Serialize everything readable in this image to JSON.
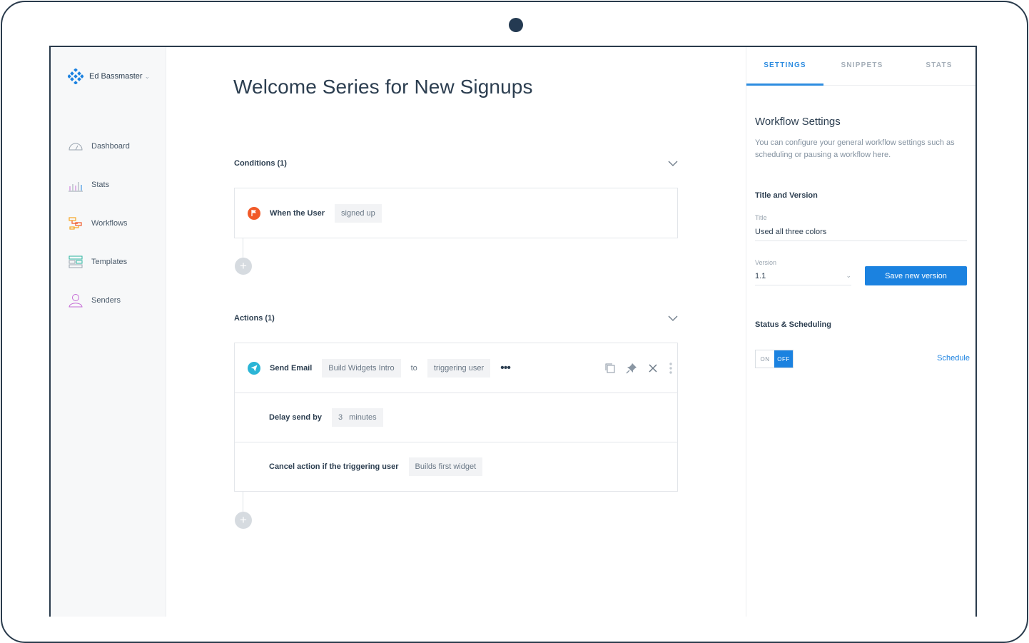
{
  "account": {
    "name": "Ed Bassmaster"
  },
  "sidebar": {
    "items": [
      {
        "label": "Dashboard",
        "icon": "dashboard-gauge-icon"
      },
      {
        "label": "Stats",
        "icon": "stats-bars-icon"
      },
      {
        "label": "Workflows",
        "icon": "workflows-icon"
      },
      {
        "label": "Templates",
        "icon": "templates-icon"
      },
      {
        "label": "Senders",
        "icon": "senders-user-icon"
      }
    ]
  },
  "main": {
    "title": "Welcome Series for New Signups",
    "conditions": {
      "heading": "Conditions (1)",
      "rows": [
        {
          "label": "When the User",
          "value": "signed up"
        }
      ]
    },
    "actions": {
      "heading": "Actions (1)",
      "send": {
        "label": "Send Email",
        "template": "Build Widgets Intro",
        "to": "to",
        "recipient": "triggering user",
        "more": "•••"
      },
      "delay": {
        "label": "Delay send by",
        "amount": "3",
        "unit": "minutes"
      },
      "cancel": {
        "label": "Cancel action if the triggering user",
        "value": "Builds first widget"
      }
    }
  },
  "panel": {
    "tabs": [
      "SETTINGS",
      "SNIPPETS",
      "STATS"
    ],
    "title": "Workflow Settings",
    "description": "You can configure your general workflow settings such as scheduling or pausing a workflow here.",
    "title_version_heading": "Title and Version",
    "title_label": "Title",
    "title_value": "Used all three colors",
    "version_label": "Version",
    "version_value": "1.1",
    "save_label": "Save new version",
    "status_heading": "Status & Scheduling",
    "toggle_on": "ON",
    "toggle_off": "OFF",
    "schedule_label": "Schedule"
  },
  "colors": {
    "accent": "#1b82e0",
    "condition_icon": "#f15a29",
    "action_icon": "#2bb5d6"
  }
}
